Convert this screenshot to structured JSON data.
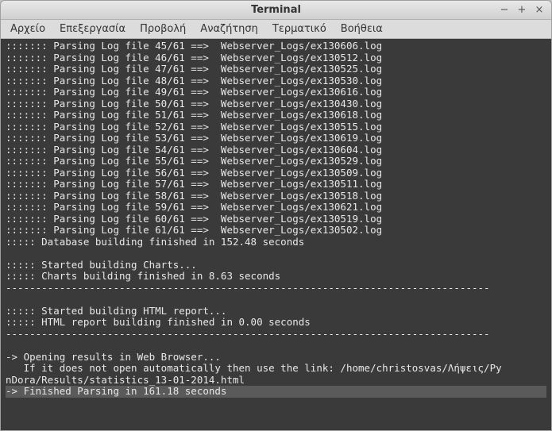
{
  "window": {
    "title": "Terminal"
  },
  "menu": {
    "file": "Αρχείο",
    "edit": "Επεξεργασία",
    "view": "Προβολή",
    "search": "Αναζήτηση",
    "terminal": "Τερματικό",
    "help": "Βοήθεια"
  },
  "controls": {
    "minimize": "−",
    "maximize": "+",
    "close": "×"
  },
  "log_prefix": "::::::: Parsing Log file ",
  "log_arrow": " ==>  ",
  "log_total": 61,
  "log_lines": [
    {
      "n": 45,
      "file": "Webserver_Logs/ex130606.log"
    },
    {
      "n": 46,
      "file": "Webserver_Logs/ex130512.log"
    },
    {
      "n": 47,
      "file": "Webserver_Logs/ex130525.log"
    },
    {
      "n": 48,
      "file": "Webserver_Logs/ex130530.log"
    },
    {
      "n": 49,
      "file": "Webserver_Logs/ex130616.log"
    },
    {
      "n": 50,
      "file": "Webserver_Logs/ex130430.log"
    },
    {
      "n": 51,
      "file": "Webserver_Logs/ex130618.log"
    },
    {
      "n": 52,
      "file": "Webserver_Logs/ex130515.log"
    },
    {
      "n": 53,
      "file": "Webserver_Logs/ex130619.log"
    },
    {
      "n": 54,
      "file": "Webserver_Logs/ex130604.log"
    },
    {
      "n": 55,
      "file": "Webserver_Logs/ex130529.log"
    },
    {
      "n": 56,
      "file": "Webserver_Logs/ex130509.log"
    },
    {
      "n": 57,
      "file": "Webserver_Logs/ex130511.log"
    },
    {
      "n": 58,
      "file": "Webserver_Logs/ex130518.log"
    },
    {
      "n": 59,
      "file": "Webserver_Logs/ex130621.log"
    },
    {
      "n": 60,
      "file": "Webserver_Logs/ex130519.log"
    },
    {
      "n": 61,
      "file": "Webserver_Logs/ex130502.log"
    }
  ],
  "messages": {
    "db_finished": "::::: Database building finished in 152.48 seconds",
    "blank": "",
    "charts_start": "::::: Started building Charts...",
    "charts_end": "::::: Charts building finished in 8.63 seconds",
    "dashes": "---------------------------------------------------------------------------------",
    "html_start": "::::: Started building HTML report...",
    "html_end": "::::: HTML report building finished in 0.00 seconds",
    "open_browser": "-> Opening results in Web Browser...",
    "open_hint1": "   If it does not open automatically then use the link: /home/christosvas/Λήψεις/Py",
    "open_hint2": "nDora/Results/statistics_13-01-2014.html",
    "finished": "-> Finished Parsing in 161.18 seconds"
  }
}
